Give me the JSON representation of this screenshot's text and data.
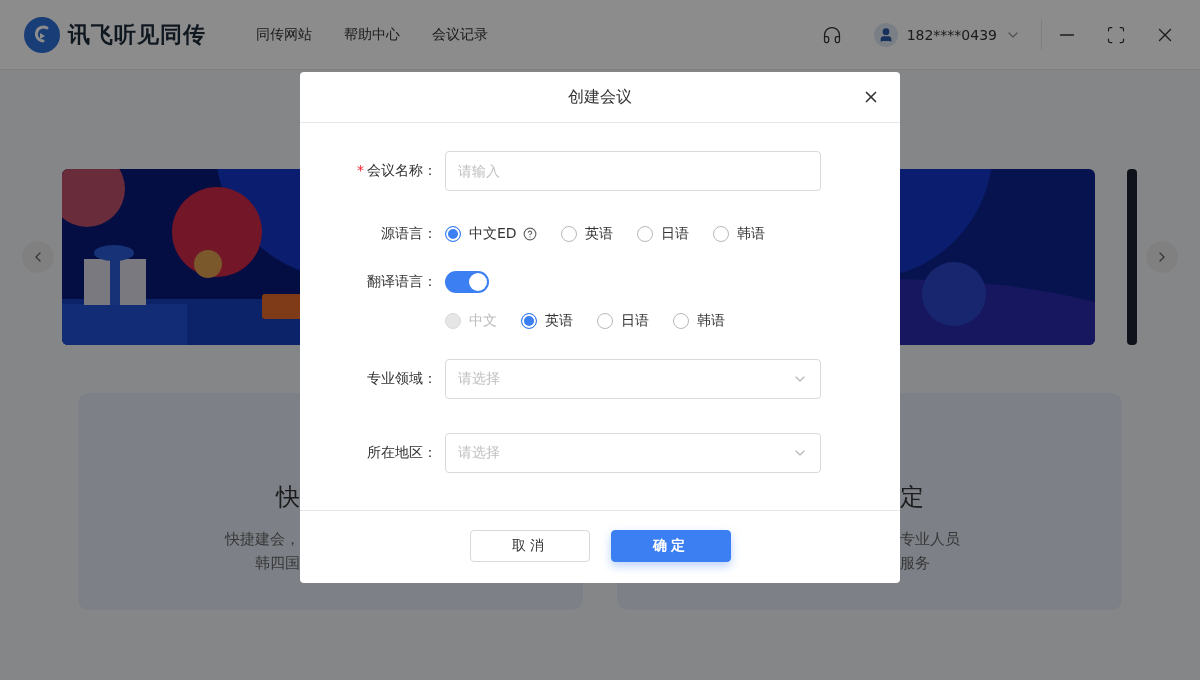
{
  "header": {
    "app_name": "讯飞听见同传",
    "nav": [
      {
        "label": "同传网站"
      },
      {
        "label": "帮助中心"
      },
      {
        "label": "会议记录"
      }
    ],
    "user": {
      "phone": "182****0439"
    }
  },
  "cards": [
    {
      "title": "快",
      "lines": [
        "快捷建会，",
        "韩四国"
      ]
    },
    {
      "title": "定",
      "lines": [
        "专业人员",
        "服务"
      ]
    }
  ],
  "dialog": {
    "title": "创建会议",
    "fields": [
      {
        "kind": "input",
        "label": "会议名称：",
        "required_mark": "*",
        "placeholder": "请输入"
      },
      {
        "kind": "radio",
        "label": "源语言：",
        "options": [
          {
            "label": "中文ED",
            "selected": true,
            "disabled": false,
            "help": true
          },
          {
            "label": "英语",
            "selected": false,
            "disabled": false
          },
          {
            "label": "日语",
            "selected": false,
            "disabled": false
          },
          {
            "label": "韩语",
            "selected": false,
            "disabled": false
          }
        ]
      },
      {
        "kind": "switch",
        "label": "翻译语言：",
        "on": true
      },
      {
        "kind": "radio",
        "options": [
          {
            "label": "中文",
            "selected": false,
            "disabled": true
          },
          {
            "label": "英语",
            "selected": true,
            "disabled": false
          },
          {
            "label": "日语",
            "selected": false,
            "disabled": false
          },
          {
            "label": "韩语",
            "selected": false,
            "disabled": false
          }
        ]
      },
      {
        "kind": "select",
        "label": "专业领域：",
        "placeholder": "请选择"
      },
      {
        "kind": "select",
        "label": "所在地区：",
        "placeholder": "请选择"
      }
    ],
    "buttons": [
      {
        "label": "取消",
        "primary": false
      },
      {
        "label": "确定",
        "primary": true
      }
    ]
  }
}
